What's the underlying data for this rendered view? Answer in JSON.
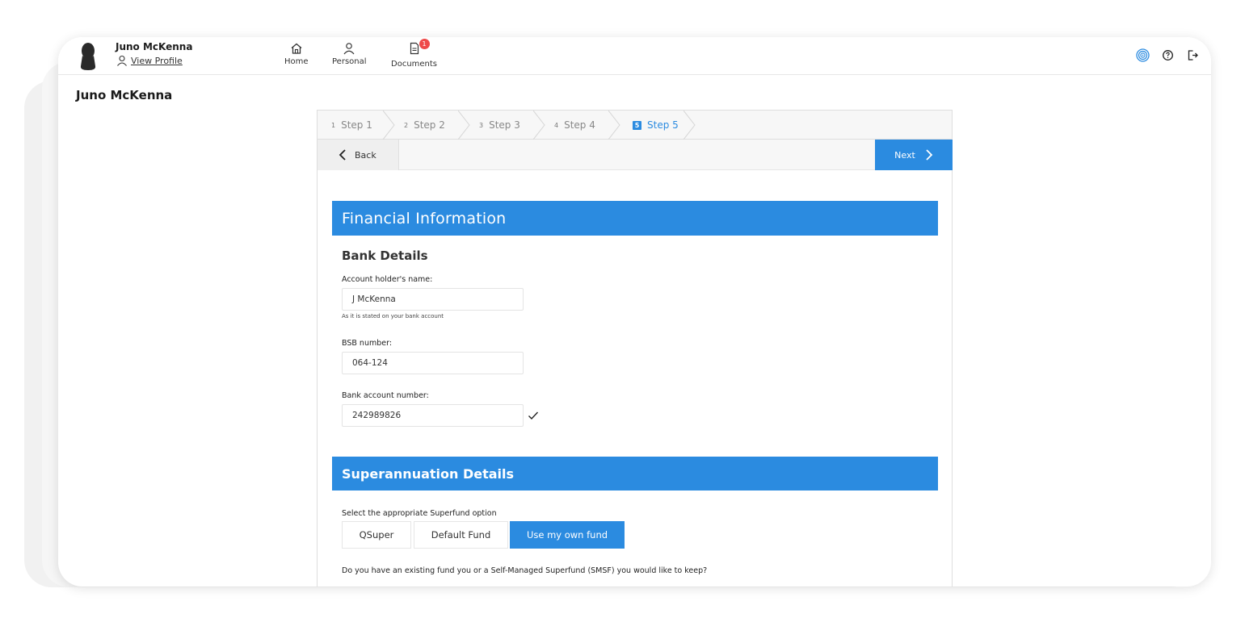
{
  "topbar": {
    "user_name": "Juno McKenna",
    "view_profile": "View Profile",
    "nav": [
      {
        "label": "Home",
        "icon": "home-icon"
      },
      {
        "label": "Personal",
        "icon": "person-icon"
      },
      {
        "label": "Documents",
        "icon": "document-icon",
        "badge": "1"
      }
    ]
  },
  "page": {
    "heading": "Juno McKenna"
  },
  "wizard": {
    "steps": [
      {
        "num": "1",
        "label": "Step 1"
      },
      {
        "num": "2",
        "label": "Step 2"
      },
      {
        "num": "3",
        "label": "Step 3"
      },
      {
        "num": "4",
        "label": "Step 4"
      },
      {
        "num": "5",
        "label": "Step 5",
        "active": true
      }
    ],
    "back_label": "Back",
    "next_label": "Next"
  },
  "financial": {
    "title": "Financial Information",
    "bank_heading": "Bank Details",
    "account_holder_label": "Account holder's name:",
    "account_holder_value": "J McKenna",
    "account_holder_hint": "As it is stated on your bank account",
    "bsb_label": "BSB number:",
    "bsb_value": "064-124",
    "account_number_label": "Bank account number:",
    "account_number_value": "242989826"
  },
  "super": {
    "title": "Superannuation Details",
    "select_label": "Select the appropriate Superfund option",
    "options": [
      "QSuper",
      "Default Fund",
      "Use my own fund"
    ],
    "selected": "Use my own fund",
    "question": "Do you have an existing fund you or a Self-Managed Superfund (SMSF) you would like to keep?"
  },
  "colors": {
    "accent": "#2b8be0",
    "badge": "#ee4a4a"
  }
}
